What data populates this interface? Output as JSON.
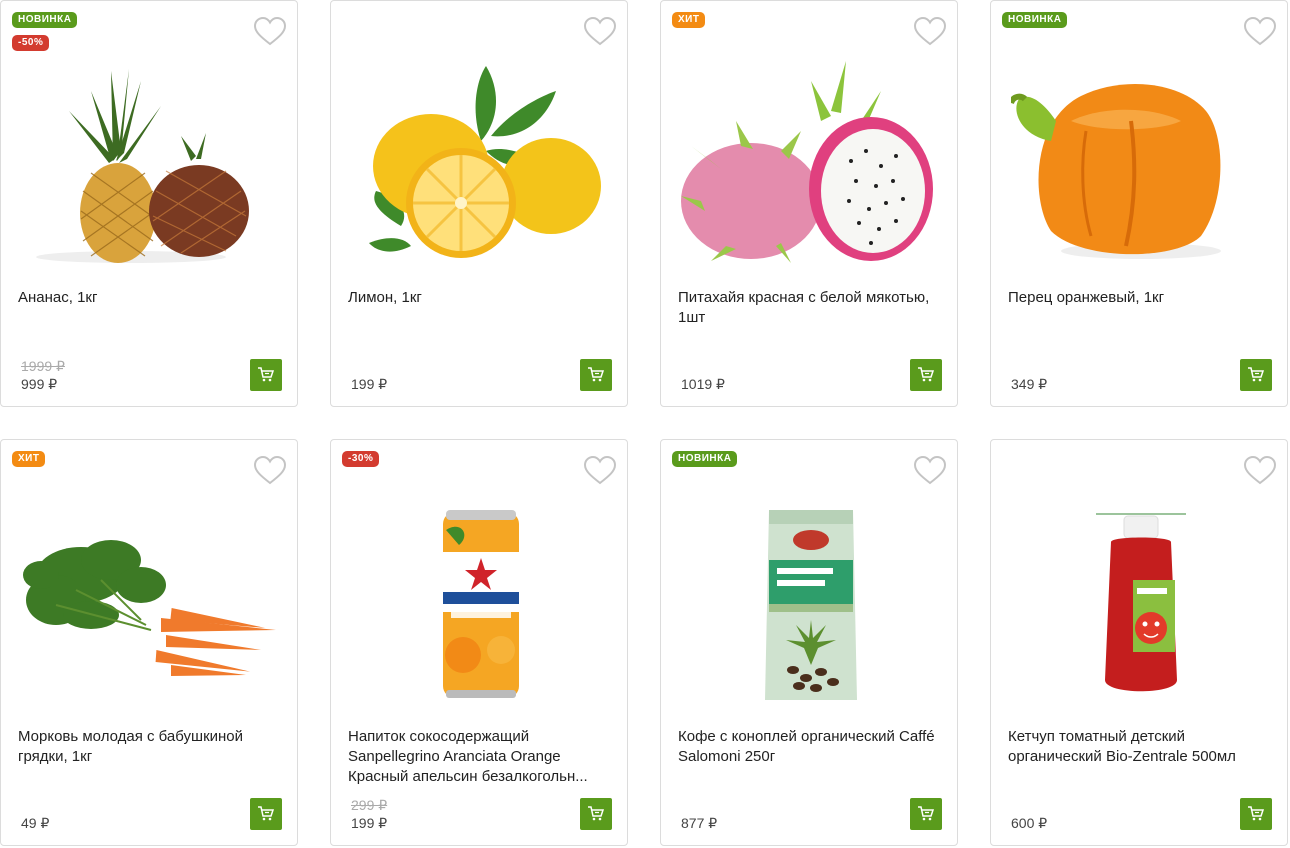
{
  "currency": "₽",
  "colors": {
    "accent": "#5a9b1c",
    "hit": "#f38b13",
    "sale": "#d33b2f"
  },
  "products": [
    {
      "name": "Ананас, 1кг",
      "badges": [
        "НОВИНКА",
        "-50%"
      ],
      "old_price": "1999 ₽",
      "price": "999 ₽",
      "image": "pineapple"
    },
    {
      "name": "Лимон, 1кг",
      "badges": [],
      "old_price": "",
      "price": "199 ₽",
      "image": "lemon"
    },
    {
      "name": "Питахайя красная с белой мякотью, 1шт",
      "badges": [
        "ХИТ"
      ],
      "old_price": "",
      "price": "1019 ₽",
      "image": "pitahaya"
    },
    {
      "name": "Перец оранжевый, 1кг",
      "badges": [
        "НОВИНКА"
      ],
      "old_price": "",
      "price": "349 ₽",
      "image": "orange-pepper"
    },
    {
      "name": "Морковь молодая с бабушкиной грядки, 1кг",
      "badges": [
        "ХИТ"
      ],
      "old_price": "",
      "price": "49 ₽",
      "image": "carrot"
    },
    {
      "name": "Напиток сокосодержащий Sanpellegrino Aranciata Orange Красный апельсин безалкогольн...",
      "badges": [
        "-30%"
      ],
      "old_price": "299 ₽",
      "price": "199 ₽",
      "image": "sanpellegrino-can"
    },
    {
      "name": "Кофе с коноплей органический Caffé Salomoni 250г",
      "badges": [
        "НОВИНКА"
      ],
      "old_price": "",
      "price": "877 ₽",
      "image": "coffee-pack"
    },
    {
      "name": "Кетчуп томатный детский органический Bio-Zentrale 500мл",
      "badges": [],
      "old_price": "",
      "price": "600 ₽",
      "image": "ketchup-bottle"
    }
  ]
}
